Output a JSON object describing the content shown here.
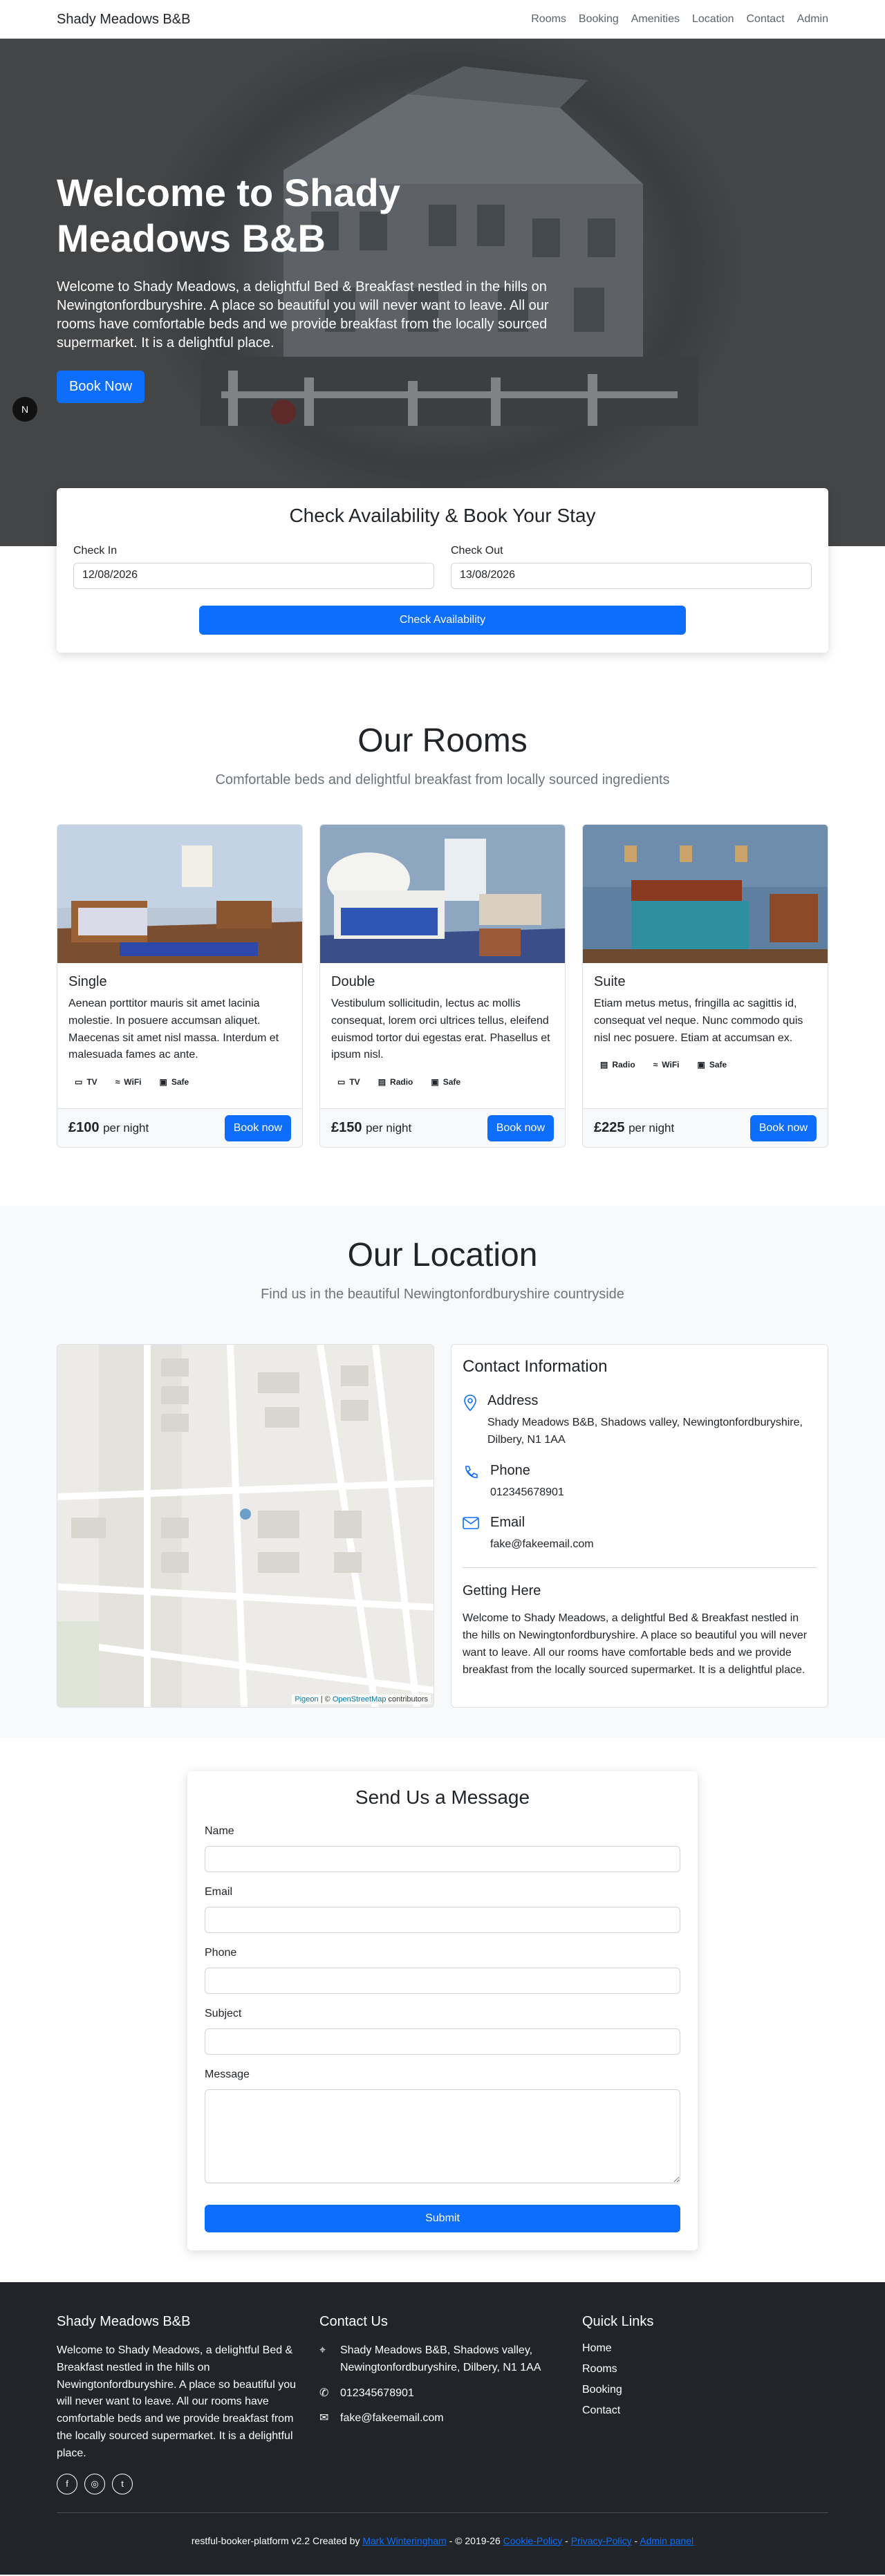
{
  "nav": {
    "brand": "Shady Meadows B&B",
    "links": [
      "Rooms",
      "Booking",
      "Amenities",
      "Location",
      "Contact",
      "Admin"
    ]
  },
  "hero": {
    "title": "Welcome to Shady Meadows B&B",
    "text": "Welcome to Shady Meadows, a delightful Bed & Breakfast nestled in the hills on Newingtonfordburyshire. A place so beautiful you will never want to leave. All our rooms have comfortable beds and we provide breakfast from the locally sourced supermarket. It is a delightful place.",
    "button": "Book Now",
    "badge": "N"
  },
  "booking": {
    "title": "Check Availability & Book Your Stay",
    "checkin_label": "Check In",
    "checkin_value": "12/08/2026",
    "checkout_label": "Check Out",
    "checkout_value": "13/08/2026",
    "button": "Check Availability"
  },
  "rooms": {
    "title": "Our Rooms",
    "subtitle": "Comfortable beds and delightful breakfast from locally sourced ingredients",
    "per_night": "per night",
    "book_label": "Book now",
    "items": [
      {
        "name": "Single",
        "description": "Aenean porttitor mauris sit amet lacinia molestie. In posuere accumsan aliquet. Maecenas sit amet nisl massa. Interdum et malesuada fames ac ante.",
        "features": [
          "TV",
          "WiFi",
          "Safe"
        ],
        "price": "£100"
      },
      {
        "name": "Double",
        "description": "Vestibulum sollicitudin, lectus ac mollis consequat, lorem orci ultrices tellus, eleifend euismod tortor dui egestas erat. Phasellus et ipsum nisl.",
        "features": [
          "TV",
          "Radio",
          "Safe"
        ],
        "price": "£150"
      },
      {
        "name": "Suite",
        "description": "Etiam metus metus, fringilla ac sagittis id, consequat vel neque. Nunc commodo quis nisl nec posuere. Etiam at accumsan ex.",
        "features": [
          "Radio",
          "WiFi",
          "Safe"
        ],
        "price": "£225"
      }
    ]
  },
  "location": {
    "title": "Our Location",
    "subtitle": "Find us in the beautiful Newingtonfordburyshire countryside",
    "map_attribution_a": "Pigeon",
    "map_attribution_b": "© ",
    "map_attribution_c": "OpenStreetMap",
    "map_attribution_d": " contributors",
    "contact_title": "Contact Information",
    "address_label": "Address",
    "address": "Shady Meadows B&B, Shadows valley, Newingtonfordburyshire, Dilbery, N1 1AA",
    "phone_label": "Phone",
    "phone": "012345678901",
    "email_label": "Email",
    "email": "fake@fakeemail.com",
    "getting_title": "Getting Here",
    "getting_text": "Welcome to Shady Meadows, a delightful Bed & Breakfast nestled in the hills on Newingtonfordburyshire. A place so beautiful you will never want to leave. All our rooms have comfortable beds and we provide breakfast from the locally sourced supermarket. It is a delightful place."
  },
  "message": {
    "title": "Send Us a Message",
    "name_label": "Name",
    "email_label": "Email",
    "phone_label": "Phone",
    "subject_label": "Subject",
    "message_label": "Message",
    "submit": "Submit"
  },
  "footer": {
    "brand": "Shady Meadows B&B",
    "about": "Welcome to Shady Meadows, a delightful Bed & Breakfast nestled in the hills on Newingtonfordburyshire. A place so beautiful you will never want to leave. All our rooms have comfortable beds and we provide breakfast from the locally sourced supermarket. It is a delightful place.",
    "contact_title": "Contact Us",
    "address": "Shady Meadows B&B, Shadows valley, Newingtonfordburyshire, Dilbery, N1 1AA",
    "phone": "012345678901",
    "email": "fake@fakeemail.com",
    "links_title": "Quick Links",
    "links": [
      "Home",
      "Rooms",
      "Booking",
      "Contact"
    ],
    "copy_a": "restful-booker-platform v2.2 Created by ",
    "copy_author": "Mark Winteringham",
    "copy_b": " - © 2019-26 ",
    "copy_cookie": "Cookie-Policy",
    "copy_sep1": " - ",
    "copy_privacy": "Privacy-Policy",
    "copy_sep2": " - ",
    "copy_admin": "Admin panel"
  },
  "colors": {
    "primary": "#0d6efd",
    "footer_bg": "#212529",
    "section_bg": "#f8f9fa"
  }
}
